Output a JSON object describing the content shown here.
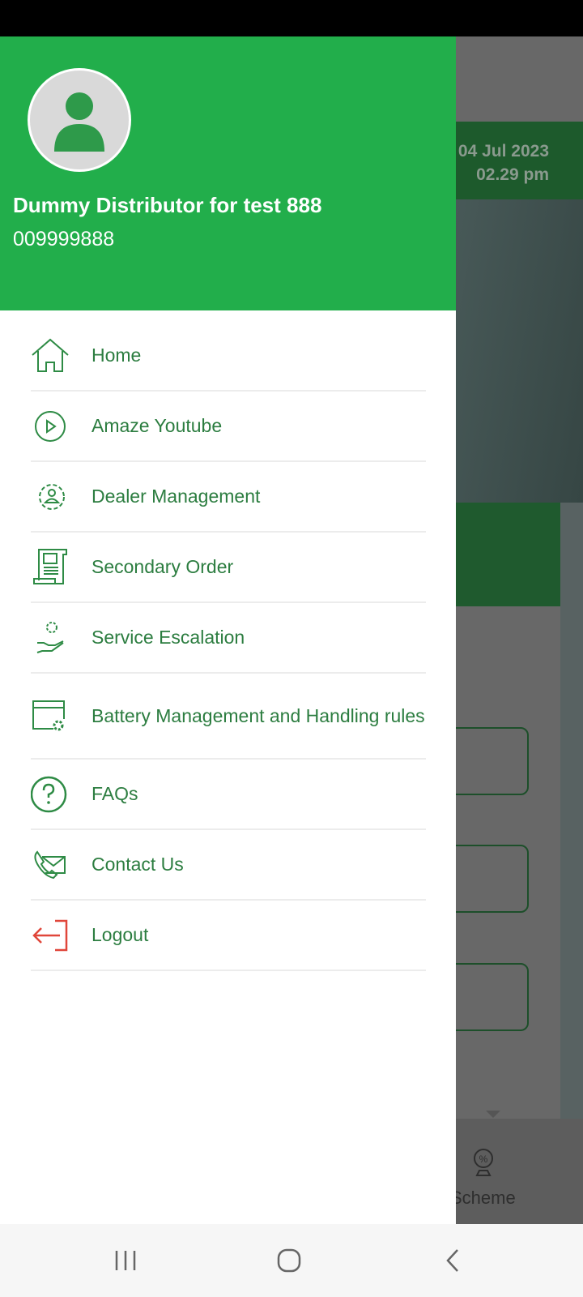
{
  "background": {
    "date": "04 Jul 2023",
    "time": "02.29 pm",
    "bottom_tab_label": "Scheme"
  },
  "drawer": {
    "user_name": "Dummy Distributor for test 888",
    "user_phone": "009999888",
    "items": [
      {
        "label": "Home",
        "icon": "home-icon"
      },
      {
        "label": "Amaze Youtube",
        "icon": "play-circle-icon"
      },
      {
        "label": "Dealer Management",
        "icon": "user-gear-icon"
      },
      {
        "label": "Secondary Order",
        "icon": "order-scroll-icon"
      },
      {
        "label": "Service Escalation",
        "icon": "service-hand-gear-icon"
      },
      {
        "label": "Battery Management and Handling rules",
        "icon": "browser-settings-icon"
      },
      {
        "label": "FAQs",
        "icon": "question-circle-icon"
      },
      {
        "label": "Contact Us",
        "icon": "contact-phone-mail-icon"
      },
      {
        "label": "Logout",
        "icon": "logout-icon"
      }
    ]
  },
  "colors": {
    "header": "#22ae4b",
    "menu_text": "#2c7d40",
    "logout_icon": "#e0463a"
  }
}
